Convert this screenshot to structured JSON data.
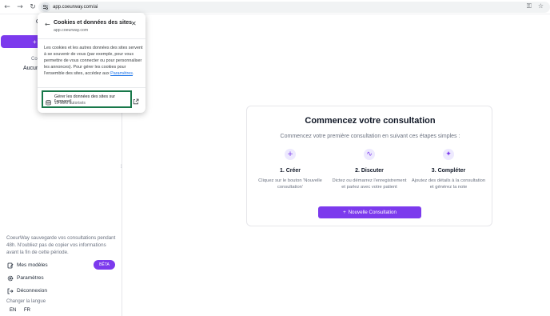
{
  "browser": {
    "url": "app.coeurway.com/ai",
    "back_glyph": "←",
    "forward_glyph": "→",
    "reload_glyph": "↻",
    "key_glyph": "⚿",
    "star_glyph": "☆"
  },
  "sidebar": {
    "top_fragment": "C",
    "new_btn_fragment": "+",
    "label_fragment": "Co",
    "empty_fragment": "Aucun",
    "retention_notice": "CoeurWay sauvegarde vos consultations pendant 48h. N'oubliez pas de copier vos informations avant la fin de cette période.",
    "items": [
      {
        "label": "Mes modèles",
        "icon": "document-edit-icon"
      },
      {
        "label": "Paramètres",
        "icon": "gear-icon"
      },
      {
        "label": "Déconnexion",
        "icon": "logout-icon"
      }
    ],
    "beta_badge": "BÊTA",
    "language_label": "Changer la langue",
    "languages": [
      "EN",
      "FR"
    ],
    "collapse_glyph": "⁞"
  },
  "popup": {
    "title": "Cookies et données des sites",
    "domain": "app.coeurway.com",
    "back_glyph": "←",
    "close_glyph": "✕",
    "description": "Les cookies et les autres données des sites servent à se souvenir de vous (par exemple, pour vous permettre de vous connecter ou pour personnaliser les annonces). Pour gérer les cookies pour l'ensemble des sites, accédez aux",
    "settings_link": "Paramètres",
    "period": ".",
    "manage_title": "Gérer les données des sites sur l'appareil",
    "manage_sub": "15 sites autorisés"
  },
  "main": {
    "title": "Commencez votre consultation",
    "subtitle": "Commencez votre première consultation en suivant ces étapes simples :",
    "steps": [
      {
        "title": "1. Créer",
        "desc": "Cliquez sur le bouton 'Nouvelle consultation'",
        "icon": "plus-icon",
        "glyph": "+"
      },
      {
        "title": "2. Discuter",
        "desc": "Dictez ou démarrez l'enregistrement et parlez avec votre patient",
        "icon": "audio-wave-icon",
        "glyph": "∿"
      },
      {
        "title": "3. Compléter",
        "desc": "Ajoutez des détails à la consultation et générez la note",
        "icon": "sparkle-icon",
        "glyph": "✦"
      }
    ],
    "cta_glyph": "+",
    "cta_label": "Nouvelle Consultation"
  },
  "colors": {
    "accent": "#7c3aed",
    "accent_soft": "#ede9fe",
    "highlight_border": "#18784a",
    "link": "#1a73e8"
  }
}
